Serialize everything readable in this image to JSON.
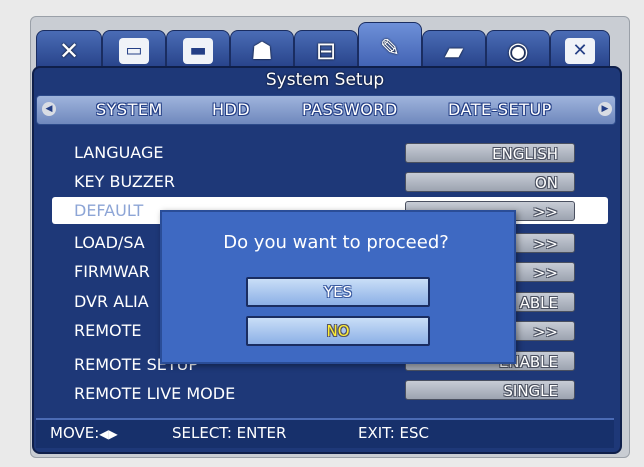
{
  "window": {
    "title": "System Setup"
  },
  "tabs": [
    {
      "icon": "tools-icon"
    },
    {
      "icon": "monitor-icon"
    },
    {
      "icon": "record-icon"
    },
    {
      "icon": "camera-icon"
    },
    {
      "icon": "network-icon"
    },
    {
      "icon": "system-setup-icon",
      "active": true
    },
    {
      "icon": "folder-icon"
    },
    {
      "icon": "disk-icon"
    },
    {
      "icon": "close-icon"
    }
  ],
  "subtabs": [
    "SYSTEM",
    "HDD",
    "PASSWORD",
    "DATE-SETUP"
  ],
  "rows": [
    {
      "label": "LANGUAGE",
      "value": "ENGLISH"
    },
    {
      "label": "KEY BUZZER",
      "value": "ON"
    },
    {
      "label": "DEFAULT",
      "value": ">>"
    },
    {
      "label": "LOAD/SA",
      "value": ">>"
    },
    {
      "label": "FIRMWAR",
      "value": ">>"
    },
    {
      "label": "DVR ALIA",
      "value": "ABLE"
    },
    {
      "label": "REMOTE",
      "value": ">>"
    },
    {
      "label": "REMOTE SETUP",
      "value": "ENABLE"
    },
    {
      "label": "REMOTE LIVE MODE",
      "value": "SINGLE"
    }
  ],
  "dialog": {
    "question": "Do you want to proceed?",
    "yes_label": "YES",
    "no_label": "NO"
  },
  "footer": {
    "move": "MOVE:",
    "move_arrows": "◀▶",
    "select": "SELECT: ENTER",
    "exit": "EXIT: ESC"
  },
  "colors": {
    "panel": "#1e3878",
    "dialog": "#3e69c2",
    "highlight_text": "#ffee33"
  }
}
